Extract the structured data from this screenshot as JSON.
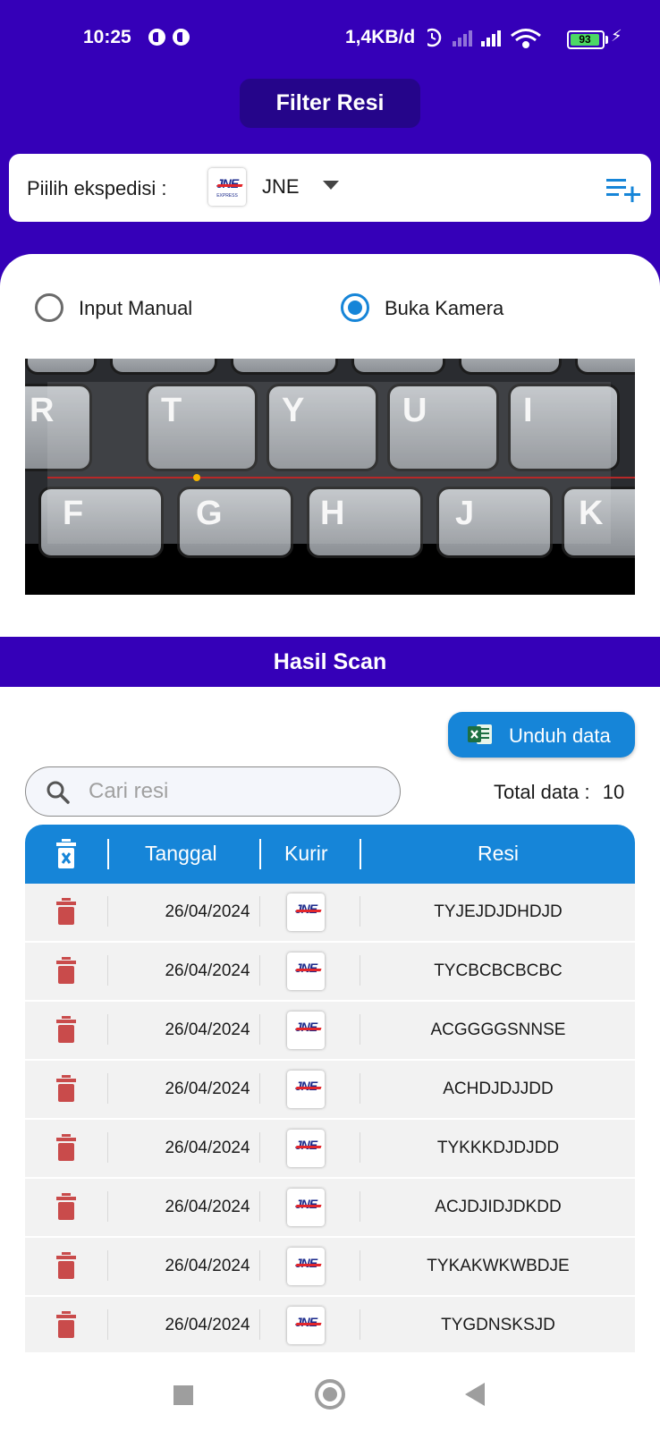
{
  "status_bar": {
    "time": "10:25",
    "network_speed": "1,4KB/d",
    "battery_level": "93"
  },
  "header": {
    "title": "Filter Resi"
  },
  "expedisi": {
    "label": "Piilih ekspedisi :",
    "selected": "JNE",
    "logo_text": "JNE",
    "logo_subtext": "EXPRESS"
  },
  "scan_mode": {
    "options": [
      {
        "label": "Input Manual",
        "selected": false
      },
      {
        "label": "Buka Kamera",
        "selected": true
      }
    ]
  },
  "camera": {
    "keys_row1": [
      "R",
      "T",
      "Y",
      "U",
      "I"
    ],
    "keys_row2": [
      "F",
      "G",
      "H",
      "J",
      "K"
    ]
  },
  "hasil": {
    "title": "Hasil Scan",
    "download_label": "Unduh data",
    "search_placeholder": "Cari resi",
    "total_label": "Total data :",
    "total_value": "10"
  },
  "table": {
    "columns": [
      "Tanggal",
      "Kurir",
      "Resi"
    ],
    "rows": [
      {
        "tanggal": "26/04/2024",
        "kurir": "JNE",
        "resi": "TYJEJDJDHDJD"
      },
      {
        "tanggal": "26/04/2024",
        "kurir": "JNE",
        "resi": "TYCBCBCBCBC"
      },
      {
        "tanggal": "26/04/2024",
        "kurir": "JNE",
        "resi": "ACGGGGSNNSE"
      },
      {
        "tanggal": "26/04/2024",
        "kurir": "JNE",
        "resi": "ACHDJDJJDD"
      },
      {
        "tanggal": "26/04/2024",
        "kurir": "JNE",
        "resi": "TYKKKDJDJDD"
      },
      {
        "tanggal": "26/04/2024",
        "kurir": "JNE",
        "resi": "ACJDJIDJDKDD"
      },
      {
        "tanggal": "26/04/2024",
        "kurir": "JNE",
        "resi": "TYKAKWKWBDJE"
      },
      {
        "tanggal": "26/04/2024",
        "kurir": "JNE",
        "resi": "TYGDNSKSJD"
      }
    ]
  },
  "colors": {
    "primary_purple": "#3500b8",
    "header_purple_dark": "#25058a",
    "accent_blue": "#1685d8",
    "delete_red": "#c94b4b"
  },
  "icons": [
    "alarm-icon",
    "signal-icon",
    "wifi-icon",
    "battery-icon",
    "playlist-add-icon",
    "excel-icon",
    "search-icon",
    "clear-all-icon",
    "trash-icon"
  ]
}
